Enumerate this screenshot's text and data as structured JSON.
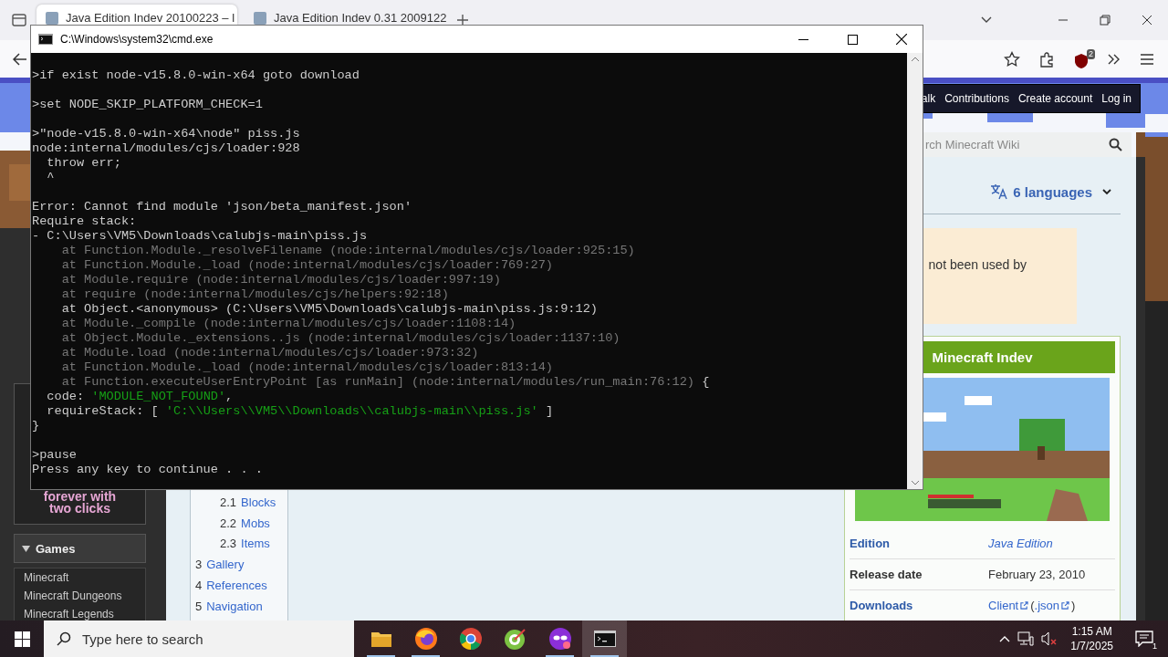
{
  "browser": {
    "tabs": [
      {
        "title": "Java Edition Indev 20100223 – l",
        "selected": true
      },
      {
        "title": "Java Edition Indev 0.31 2009122",
        "selected": false
      }
    ],
    "extension_badge": "2",
    "wiki": {
      "nav_links": [
        "alk",
        "Contributions",
        "Create account",
        "Log in"
      ],
      "search": {
        "placeholder": "rch Minecraft Wiki"
      },
      "languages": "6 languages",
      "notice": "not been used by",
      "sidebar": {
        "promo": [
          "forever with",
          "two clicks"
        ],
        "games_header": "Games",
        "games": [
          "Minecraft",
          "Minecraft Dungeons",
          "Minecraft Legends"
        ]
      },
      "toc": [
        {
          "children": [
            {
              "number": "2.1",
              "label": "Blocks"
            },
            {
              "number": "2.2",
              "label": "Mobs"
            },
            {
              "number": "2.3",
              "label": "Items"
            }
          ]
        },
        {
          "number": "3",
          "label": "Gallery"
        },
        {
          "number": "4",
          "label": "References"
        },
        {
          "number": "5",
          "label": "Navigation"
        }
      ],
      "infobox": {
        "title": "Minecraft Indev",
        "rows": [
          {
            "label": "Edition",
            "kind": "link",
            "parts": [
              {
                "text": "Java Edition",
                "kind": "italic_link"
              }
            ]
          },
          {
            "label": "Release date",
            "kind": "plain",
            "parts": [
              {
                "text": "February 23, 2010",
                "kind": "plain"
              }
            ]
          },
          {
            "label": "Downloads",
            "kind": "link",
            "parts": [
              {
                "text": "Client",
                "kind": "external_link"
              },
              {
                "text": "(",
                "kind": "plain"
              },
              {
                "text": ".json",
                "kind": "external_link"
              },
              {
                "text": ")",
                "kind": "plain"
              }
            ]
          }
        ]
      }
    }
  },
  "console": {
    "title": "C:\\Windows\\system32\\cmd.exe",
    "lines": [
      {
        "kind": "plain",
        "text": ">if exist node-v15.8.0-win-x64 goto download"
      },
      {
        "kind": "blank"
      },
      {
        "kind": "plain",
        "text": ">set NODE_SKIP_PLATFORM_CHECK=1"
      },
      {
        "kind": "blank"
      },
      {
        "kind": "plain",
        "text": ">\"node-v15.8.0-win-x64\\node\" piss.js"
      },
      {
        "kind": "plain",
        "text": "node:internal/modules/cjs/loader:928"
      },
      {
        "kind": "plain",
        "text": "  throw err;"
      },
      {
        "kind": "plain",
        "text": "  ^"
      },
      {
        "kind": "blank"
      },
      {
        "kind": "plain",
        "text": "Error: Cannot find module 'json/beta_manifest.json'"
      },
      {
        "kind": "plain",
        "text": "Require stack:"
      },
      {
        "kind": "plain",
        "text": "- C:\\Users\\VM5\\Downloads\\calubjs-main\\piss.js"
      },
      {
        "kind": "dim",
        "text": "    at Function.Module._resolveFilename (node:internal/modules/cjs/loader:925:15)"
      },
      {
        "kind": "dim",
        "text": "    at Function.Module._load (node:internal/modules/cjs/loader:769:27)"
      },
      {
        "kind": "dim",
        "text": "    at Module.require (node:internal/modules/cjs/loader:997:19)"
      },
      {
        "kind": "dim",
        "text": "    at require (node:internal/modules/cjs/helpers:92:18)"
      },
      {
        "kind": "plain",
        "text": "    at Object.<anonymous> (C:\\Users\\VM5\\Downloads\\calubjs-main\\piss.js:9:12)"
      },
      {
        "kind": "dim",
        "text": "    at Module._compile (node:internal/modules/cjs/loader:1108:14)"
      },
      {
        "kind": "dim",
        "text": "    at Object.Module._extensions..js (node:internal/modules/cjs/loader:1137:10)"
      },
      {
        "kind": "dim",
        "text": "    at Module.load (node:internal/modules/cjs/loader:973:32)"
      },
      {
        "kind": "dim",
        "text": "    at Function.Module._load (node:internal/modules/cjs/loader:813:14)"
      },
      {
        "kind": "mixed",
        "parts": [
          {
            "text": "    at Function.executeUserEntryPoint [as runMain] (node:internal/modules/run_main:76:12)",
            "kind": "dim"
          },
          {
            "text": " {",
            "kind": "plain"
          }
        ]
      },
      {
        "kind": "mixed",
        "parts": [
          {
            "text": "  code: ",
            "kind": "plain"
          },
          {
            "text": "'MODULE_NOT_FOUND'",
            "kind": "string"
          },
          {
            "text": ",",
            "kind": "plain"
          }
        ]
      },
      {
        "kind": "mixed",
        "parts": [
          {
            "text": "  requireStack: [ ",
            "kind": "plain"
          },
          {
            "text": "'C:\\\\Users\\\\VM5\\\\Downloads\\\\calubjs-main\\\\piss.js'",
            "kind": "string"
          },
          {
            "text": " ]",
            "kind": "plain"
          }
        ]
      },
      {
        "kind": "plain",
        "text": "}"
      },
      {
        "kind": "blank"
      },
      {
        "kind": "plain",
        "text": ">pause"
      },
      {
        "kind": "plain",
        "text": "Press any key to continue . . ."
      }
    ]
  },
  "taskbar": {
    "search_placeholder": "Type here to search",
    "apps": [
      {
        "kind": "folder",
        "running": true,
        "selected": false
      },
      {
        "kind": "firefox",
        "running": true,
        "selected": false
      },
      {
        "kind": "chrome",
        "running": false,
        "selected": false
      },
      {
        "kind": "target",
        "running": false,
        "selected": false
      },
      {
        "kind": "mask",
        "running": true,
        "selected": false
      },
      {
        "kind": "terminal",
        "running": true,
        "selected": true
      }
    ],
    "time": "1:15 AM",
    "date": "1/7/2025",
    "notifications": "1"
  }
}
